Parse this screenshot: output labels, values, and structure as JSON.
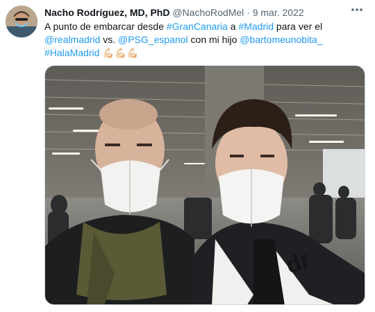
{
  "author": {
    "name": "Nacho Rodríguez, MD, PhD",
    "handle": "@NachoRodMel",
    "separator": "·",
    "date": "9 mar. 2022"
  },
  "more_icon": "more-horizontal-icon",
  "tweet": {
    "t1": "A punto de embarcar desde ",
    "h1": "#GranCanaria",
    "t2": " a ",
    "h2": "#Madrid",
    "t3": " para ver el ",
    "m1": "@realmadrid",
    "t4": " vs. ",
    "m2": "@PSG_espanol",
    "t5": " con mi hijo ",
    "m3": "@bartomeunobita_",
    "h3": "#HalaMadrid",
    "emoji": "💪🏻💪🏻💪🏻"
  },
  "media": {
    "description_icon": "photo-image"
  },
  "colors": {
    "link": "#1d9bf0",
    "text": "#0f1419",
    "secondary": "#536471"
  }
}
